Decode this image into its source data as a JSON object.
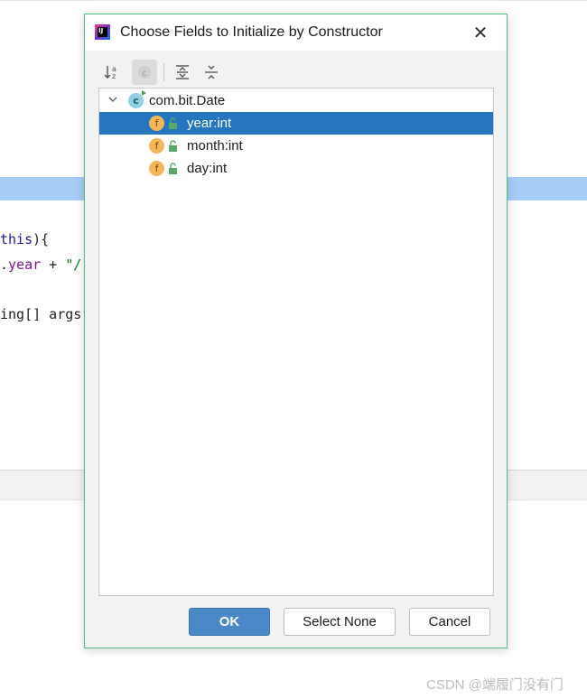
{
  "editor": {
    "lines": [
      {
        "kw": "this",
        "rest": "){"
      },
      {
        "dot": ".",
        "field": "year",
        "op": " + ",
        "str": "\"/"
      },
      {
        "text": "ing[] args"
      }
    ]
  },
  "dialog": {
    "title": "Choose Fields to Initialize by Constructor",
    "close_glyph": "✕",
    "toolbar": {
      "icons": [
        "sort-alphabetically-icon",
        "show-classes-icon",
        "expand-all-icon",
        "collapse-all-icon"
      ]
    },
    "tree": {
      "root": {
        "label": "com.bit.Date",
        "icon_letter": "c",
        "expanded": true
      },
      "fields": [
        {
          "label": "year:int",
          "icon_letter": "f",
          "selected": true
        },
        {
          "label": "month:int",
          "icon_letter": "f",
          "selected": false
        },
        {
          "label": "day:int",
          "icon_letter": "f",
          "selected": false
        }
      ]
    },
    "buttons": {
      "ok": "OK",
      "select_none": "Select None",
      "cancel": "Cancel"
    }
  },
  "watermark": "CSDN @端履门没有门",
  "colors": {
    "selection": "#2675bf",
    "ok_button": "#4a88c7",
    "dialog_border": "#4fbf87",
    "editor_highlight": "#a6cdf7"
  }
}
